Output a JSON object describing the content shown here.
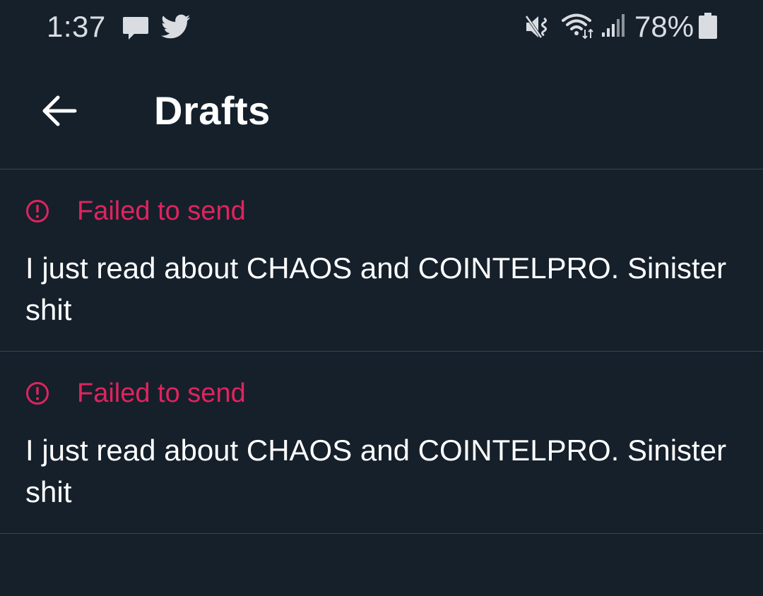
{
  "status_bar": {
    "time": "1:37",
    "battery_percent": "78%",
    "icons": [
      "message-icon",
      "twitter-icon",
      "mute-icon",
      "wifi-icon",
      "signal-icon",
      "battery-icon"
    ]
  },
  "header": {
    "title": "Drafts",
    "back_icon": "arrow-left-icon"
  },
  "drafts": [
    {
      "status": "Failed to send",
      "text": "I just read about CHAOS and COINTELPRO. Sinister shit"
    },
    {
      "status": "Failed to send",
      "text": "I just read about CHAOS and COINTELPRO. Sinister shit"
    }
  ],
  "colors": {
    "background": "#15202b",
    "divider": "#38444d",
    "error": "#e0245e",
    "text": "#ffffff",
    "status_text": "#d9dde1"
  }
}
